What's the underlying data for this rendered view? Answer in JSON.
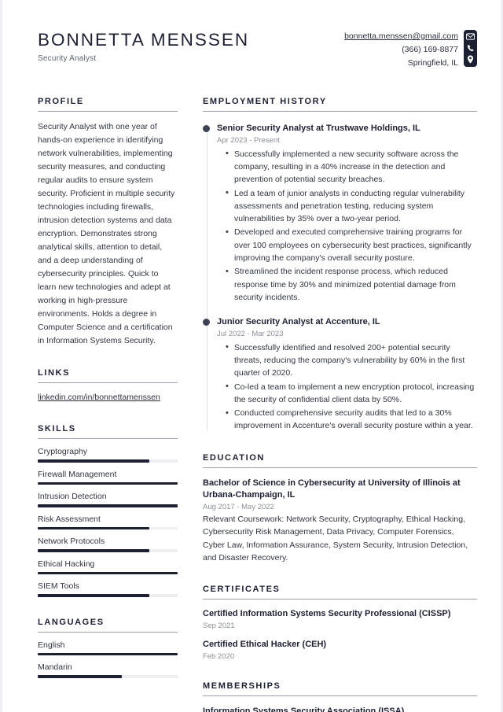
{
  "header": {
    "full_name": "BONNETTA MENSSEN",
    "job_title": "Security Analyst",
    "contact": {
      "email": "bonnetta.menssen@gmail.com",
      "phone": "(366) 169-8877",
      "location": "Springfield, IL",
      "icons": [
        "envelope-icon",
        "phone-icon",
        "map-pin-icon"
      ],
      "icon_panel_color": "#1c2033"
    }
  },
  "left": {
    "profile": {
      "heading": "PROFILE",
      "text": "Security Analyst with one year of hands-on experience in identifying network vulnerabilities, implementing security measures, and conducting regular audits to ensure system security. Proficient in multiple security technologies including firewalls, intrusion detection systems and data encryption. Demonstrates strong analytical skills, attention to detail, and a deep understanding of cybersecurity principles. Quick to learn new technologies and adept at working in high-pressure environments. Holds a degree in Computer Science and a certification in Information Systems Security."
    },
    "links": {
      "heading": "LINKS",
      "items": [
        {
          "label": "linkedin.com/in/bonnettamenssen"
        }
      ]
    },
    "skills": {
      "heading": "SKILLS",
      "items": [
        {
          "label": "Cryptography",
          "level": 80
        },
        {
          "label": "Firewall Management",
          "level": 100
        },
        {
          "label": "Intrusion Detection",
          "level": 100
        },
        {
          "label": "Risk Assessment",
          "level": 80
        },
        {
          "label": "Network Protocols",
          "level": 80
        },
        {
          "label": "Ethical Hacking",
          "level": 100
        },
        {
          "label": "SIEM Tools",
          "level": 80
        }
      ]
    },
    "languages": {
      "heading": "LANGUAGES",
      "items": [
        {
          "label": "English",
          "level": 100
        },
        {
          "label": "Mandarin",
          "level": 60
        }
      ]
    }
  },
  "right": {
    "employment": {
      "heading": "EMPLOYMENT HISTORY",
      "jobs": [
        {
          "role": "Senior Security Analyst at Trustwave Holdings, IL",
          "date": "Apr 2023 - Present",
          "bullets": [
            "Successfully implemented a new security software across the company, resulting in a 40% increase in the detection and prevention of potential security breaches.",
            "Led a team of junior analysts in conducting regular vulnerability assessments and penetration testing, reducing system vulnerabilities by 35% over a two-year period.",
            "Developed and executed comprehensive training programs for over 100 employees on cybersecurity best practices, significantly improving the company's overall security posture.",
            "Streamlined the incident response process, which reduced response time by 30% and minimized potential damage from security incidents."
          ]
        },
        {
          "role": "Junior Security Analyst at Accenture, IL",
          "date": "Jul 2022 - Mar 2023",
          "bullets": [
            "Successfully identified and resolved 200+ potential security threats, reducing the company's vulnerability by 60% in the first quarter of 2020.",
            "Co-led a team to implement a new encryption protocol, increasing the security of confidential client data by 50%.",
            "Conducted comprehensive security audits that led to a 30% improvement in Accenture's overall security posture within a year."
          ]
        }
      ]
    },
    "education": {
      "heading": "EDUCATION",
      "entries": [
        {
          "title": "Bachelor of Science in Cybersecurity at University of Illinois at Urbana-Champaign, IL",
          "date": "Aug 2017 - May 2022",
          "description": "Relevant Coursework: Network Security, Cryptography, Ethical Hacking, Cybersecurity Risk Management, Data Privacy, Computer Forensics, Cyber Law, Information Assurance, System Security, Intrusion Detection, and Disaster Recovery."
        }
      ]
    },
    "certificates": {
      "heading": "CERTIFICATES",
      "entries": [
        {
          "title": "Certified Information Systems Security Professional (CISSP)",
          "date": "Sep 2021"
        },
        {
          "title": "Certified Ethical Hacker (CEH)",
          "date": "Feb 2020"
        }
      ]
    },
    "memberships": {
      "heading": "MEMBERSHIPS",
      "entries": [
        {
          "title": "Information Systems Security Association (ISSA)"
        }
      ]
    }
  }
}
